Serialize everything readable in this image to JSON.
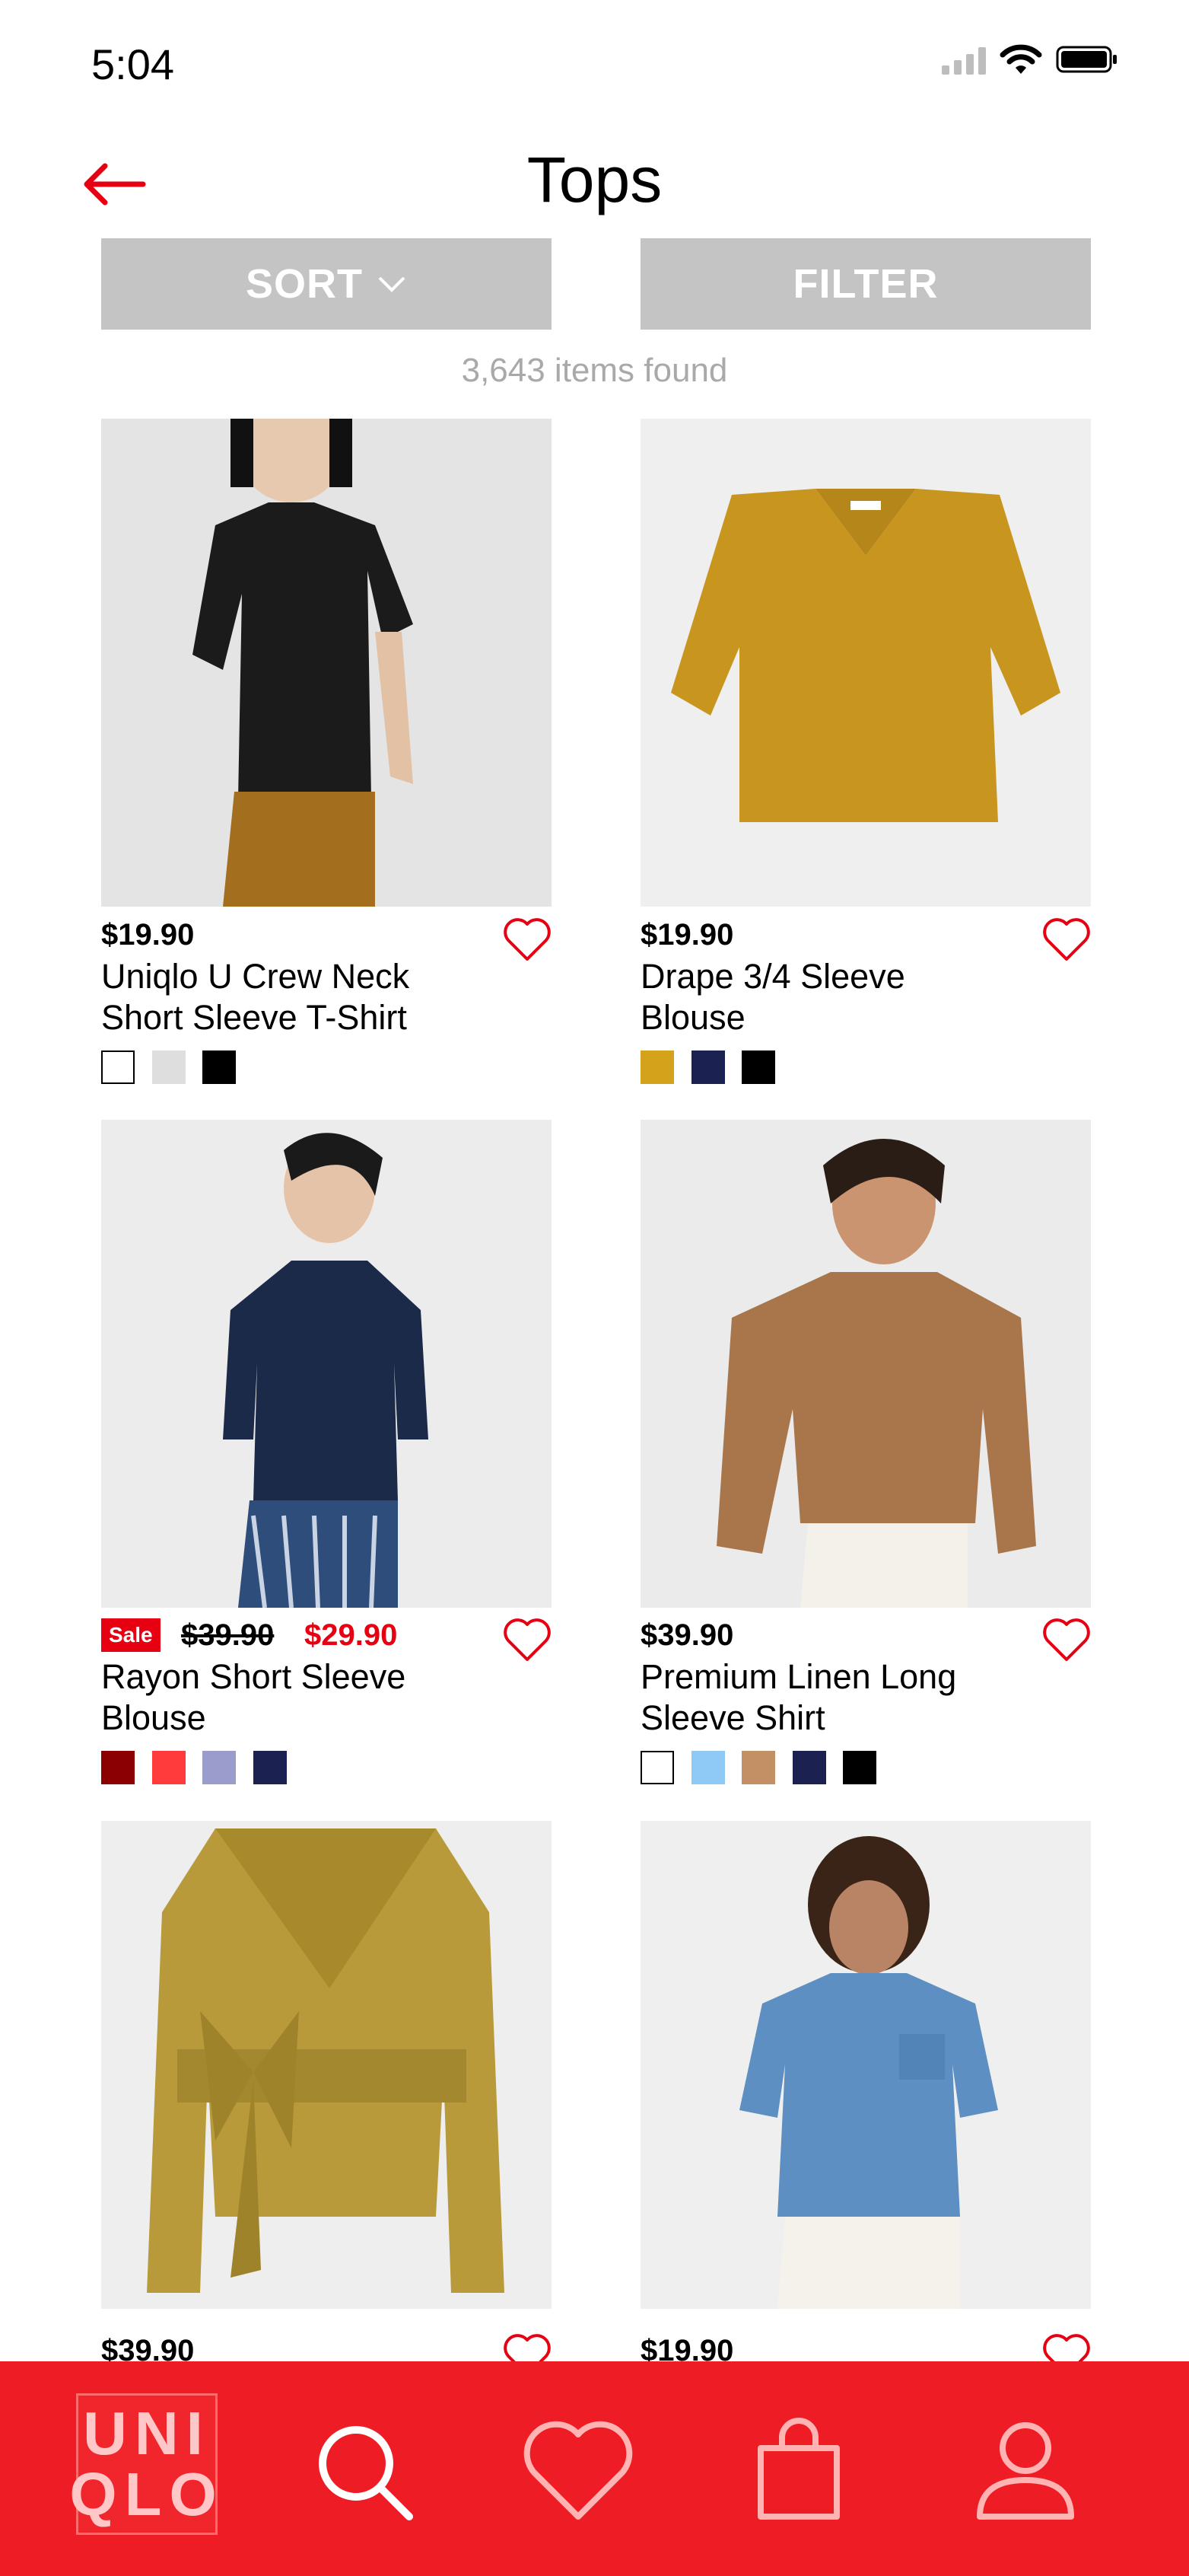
{
  "status_bar": {
    "time": "5:04"
  },
  "header": {
    "title": "Tops"
  },
  "controls": {
    "sort_label": "SORT",
    "filter_label": "FILTER"
  },
  "results": {
    "count_text": "3,643 items found"
  },
  "products": [
    {
      "price": "$19.90",
      "name_line1": "Uniqlo U Crew Neck",
      "name_line2": "Short Sleeve T-Shirt",
      "swatches": [
        "#ffffff",
        "#dedede",
        "#000000"
      ]
    },
    {
      "price": "$19.90",
      "name_line1": "Drape 3/4 Sleeve",
      "name_line2": "Blouse",
      "swatches": [
        "#d4a21b",
        "#1b2150",
        "#000000"
      ]
    },
    {
      "sale_label": "Sale",
      "old_price": "$39.90",
      "sale_price": "$29.90",
      "name_line1": "Rayon Short Sleeve",
      "name_line2": "Blouse",
      "swatches": [
        "#8b0000",
        "#ff3b3b",
        "#9a9ccc",
        "#1b2150"
      ]
    },
    {
      "price": "$39.90",
      "name_line1": "Premium Linen Long",
      "name_line2": "Sleeve Shirt",
      "swatches": [
        "#ffffff",
        "#8fcaf7",
        "#c39066",
        "#1b2150",
        "#000000"
      ]
    },
    {
      "price": "$39.90"
    },
    {
      "price": "$19.90"
    }
  ],
  "nav": {
    "logo_line1": "UNI",
    "logo_line2": "QLO",
    "icons": [
      "search-icon",
      "heart-icon",
      "bag-icon",
      "profile-icon"
    ]
  },
  "colors": {
    "accent": "#e60012",
    "nav_bg": "#ee1c25",
    "button_bg": "#c4c4c4"
  }
}
